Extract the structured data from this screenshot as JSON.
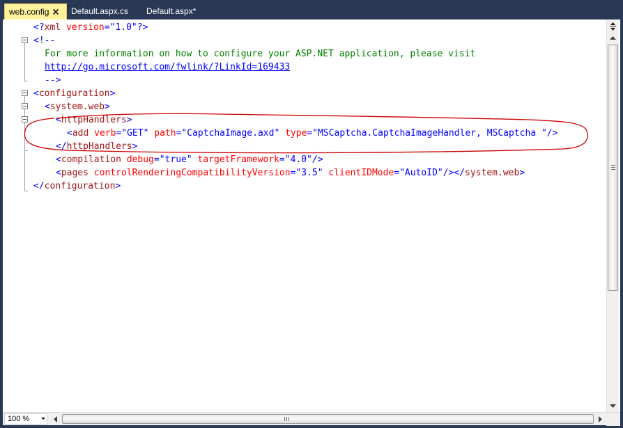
{
  "tabs": [
    {
      "label": "web.config",
      "active": true
    },
    {
      "label": "Default.aspx.cs",
      "active": false
    },
    {
      "label": "Default.aspx*",
      "active": false
    }
  ],
  "code": {
    "line1": {
      "open": "<?",
      "name": "xml",
      "attr": " version",
      "eq": "=",
      "value": "\"1.0\"",
      "close": "?>"
    },
    "line2": {
      "text": "<!--"
    },
    "line3": {
      "text": "For more information on how to configure your ASP.NET application, please visit"
    },
    "line4": {
      "link": "http://go.microsoft.com/fwlink/?LinkId=169433"
    },
    "line5": {
      "text": "-->"
    },
    "line6": {
      "lt": "<",
      "tag": "configuration",
      "gt": ">"
    },
    "line7": {
      "lt": "<",
      "tag": "system.web",
      "gt": ">"
    },
    "line8": {
      "lt": "<",
      "tag": "httpHandlers",
      "gt": ">"
    },
    "line9": {
      "lt": "<",
      "tag": "add",
      "a1": " verb",
      "v1": "\"GET\"",
      "a2": " path",
      "v2": "\"CaptchaImage.axd\"",
      "a3": " type",
      "v3": "\"MSCaptcha.CaptchaImageHandler, MSCaptcha \"",
      "end": "/>"
    },
    "line10": {
      "lt": "</",
      "tag": "httpHandlers",
      "gt": ">"
    },
    "line11": {
      "lt": "<",
      "tag": "compilation",
      "a1": " debug",
      "v1": "\"true\"",
      "a2": " targetFramework",
      "v2": "\"4.0\"",
      "end": "/>"
    },
    "line12": {
      "lt": "<",
      "tag": "pages",
      "a1": " controlRenderingCompatibilityVersion",
      "v1": "\"3.5\"",
      "a2": " clientIDMode",
      "v2": "\"AutoID\"",
      "end": "/></",
      "tag2": "system.web",
      "gt": ">"
    },
    "line13": {
      "lt": "</",
      "tag": "configuration",
      "gt": ">"
    }
  },
  "status": {
    "zoom": "100 %"
  },
  "colors": {
    "tab_active_bg": "#fff29d",
    "chrome_bg": "#293955",
    "annotation_ellipse": "#cc0000"
  },
  "icons": {
    "tab_close": "close-icon",
    "splitter": "split-icon",
    "scroll_up": "arrow-up-icon",
    "scroll_down": "arrow-down-icon",
    "scroll_left": "arrow-left-icon",
    "scroll_right": "arrow-right-icon",
    "zoom_dropdown": "chevron-down-icon"
  }
}
